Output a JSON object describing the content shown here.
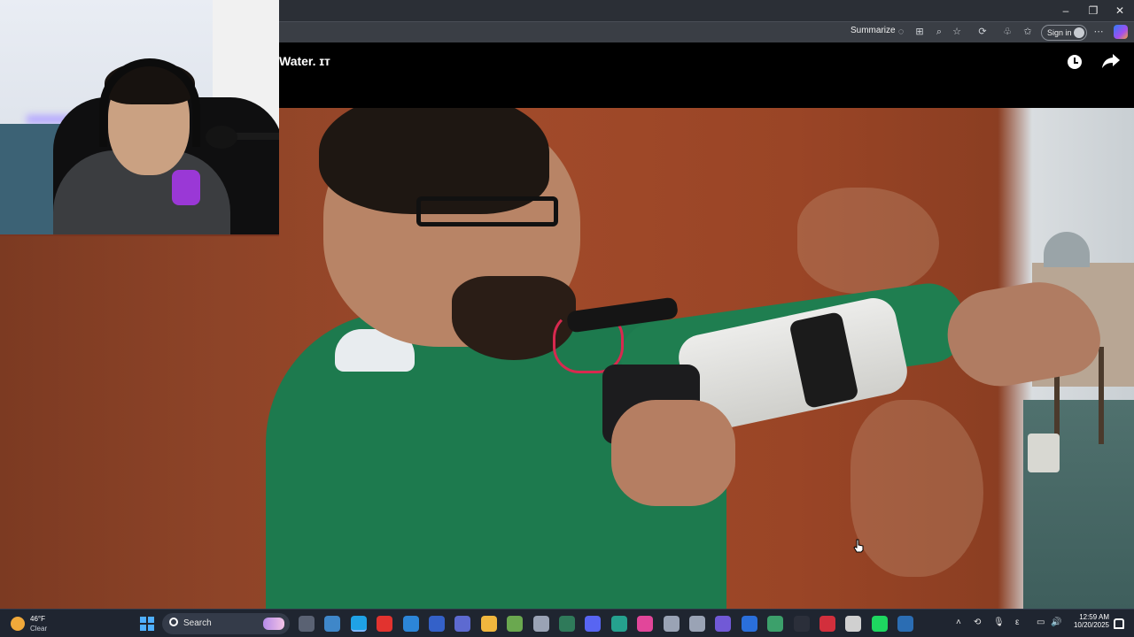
{
  "browser": {
    "toolbar": {
      "summarize_label": "Summarize",
      "signin_label": "Sign in"
    },
    "window_controls": {
      "minimize": "–",
      "restore": "❐",
      "close": "✕"
    }
  },
  "video": {
    "title": "Water. ɪᴛ"
  },
  "taskbar": {
    "weather": {
      "temp": "46°F",
      "condition": "Clear"
    },
    "search_label": "Search",
    "apps": [
      "task-view",
      "widgets",
      "edge",
      "opera",
      "store",
      "app-5",
      "app-6",
      "file-explorer",
      "app-8",
      "app-9",
      "app-10",
      "discord",
      "app-12",
      "app-13",
      "app-14",
      "app-15",
      "app-16",
      "app-17",
      "app-18",
      "app-19",
      "app-20",
      "x",
      "spotify",
      "steam"
    ],
    "time": "12:59 AM",
    "date": "10/20/2025"
  },
  "colors": {
    "titlebar": "#2b2f36",
    "toolbar": "#3a3e45",
    "taskbar": "#1f2530",
    "sweater": "#1d7a4e",
    "wall": "#a14a2a"
  }
}
